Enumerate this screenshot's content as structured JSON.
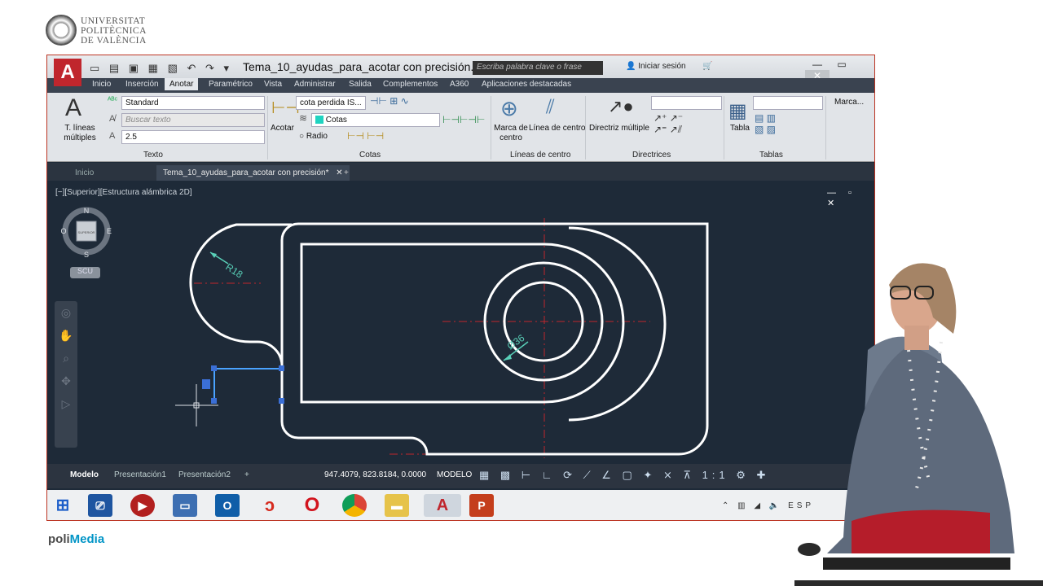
{
  "university": {
    "line1": "UNIVERSITAT",
    "line2": "POLITÈCNICA",
    "line3": "DE VALÈNCIA"
  },
  "footer": {
    "brand_prefix": "poli",
    "brand_suffix": "Media"
  },
  "titlebar": {
    "app_logo": "A",
    "document_title": "Tema_10_ayudas_para_acotar con precisión....",
    "search_placeholder": "Escriba palabra clave o frase",
    "signin": "Iniciar sesión"
  },
  "ribbon_tabs": [
    "Inicio",
    "Inserción",
    "Anotar",
    "Paramétrico",
    "Vista",
    "Administrar",
    "Salida",
    "Complementos",
    "A360",
    "Aplicaciones destacadas"
  ],
  "ribbon": {
    "text_panel": {
      "label": "Texto",
      "big_button": "T. líneas múltiples",
      "style": "Standard",
      "search": "Buscar texto",
      "height": "2.5"
    },
    "dim_panel": {
      "label": "Cotas",
      "acotar": "Acotar",
      "style": "cota perdida IS...",
      "layer": "Cotas",
      "radio": "Radio"
    },
    "center_panel": {
      "label": "Líneas de centro",
      "mark": "Marca de centro",
      "line": "Línea de centro"
    },
    "leader_panel": {
      "label": "Directrices",
      "button": "Directriz múltiple"
    },
    "table_panel": {
      "label": "Tablas",
      "button": "Tabla"
    },
    "marca": "Marca..."
  },
  "file_tabs": {
    "home": "Inicio",
    "active": "Tema_10_ayudas_para_acotar con precisión*"
  },
  "viewport": {
    "label": "[−][Superior][Estructura alámbrica 2D]",
    "cube": {
      "n": "N",
      "s": "S",
      "e": "E",
      "w": "O",
      "face": "SUPERIOR"
    },
    "ucs": "SCU"
  },
  "annotations": {
    "radius": "R18",
    "diameter": "Ø36"
  },
  "layouts": [
    "Modelo",
    "Presentación1",
    "Presentación2"
  ],
  "status": {
    "coords": "947.4079, 823.8184, 0.0000",
    "mode": "MODELO",
    "scale": "1:1"
  },
  "tray": {
    "lang": "ESP"
  },
  "colors": {
    "accent": "#c0262d",
    "canvas": "#1e2a38",
    "dim": "#59d0b8"
  }
}
